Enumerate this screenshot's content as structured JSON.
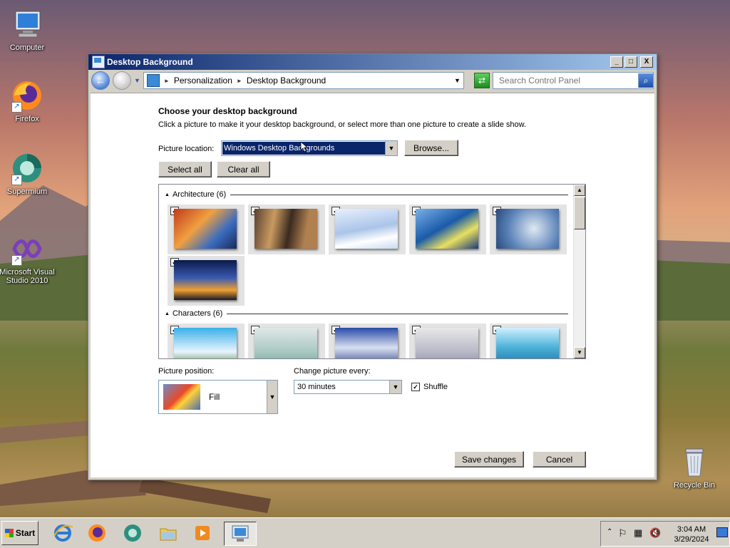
{
  "desktop": {
    "icons": [
      {
        "label": "Computer"
      },
      {
        "label": "Firefox"
      },
      {
        "label": "Supermium"
      },
      {
        "label": "Microsoft Visual Studio 2010"
      },
      {
        "label": "Recycle Bin"
      }
    ]
  },
  "window": {
    "title": "Desktop Background",
    "controls": {
      "minimize": "_",
      "maximize": "□",
      "close": "X"
    },
    "breadcrumb": [
      "Personalization",
      "Desktop Background"
    ],
    "search_placeholder": "Search Control Panel"
  },
  "content": {
    "heading": "Choose your desktop background",
    "description": "Click a picture to make it your desktop background, or select more than one picture to create a slide show.",
    "picture_location_label": "Picture location:",
    "picture_location_value": "Windows Desktop Backgrounds",
    "browse_label": "Browse...",
    "select_all_label": "Select all",
    "clear_all_label": "Clear all",
    "groups": [
      {
        "name": "Architecture (6)",
        "count": 6
      },
      {
        "name": "Characters (6)",
        "count": 6
      }
    ],
    "picture_position_label": "Picture position:",
    "picture_position_value": "Fill",
    "change_every_label": "Change picture every:",
    "change_every_value": "30 minutes",
    "shuffle_label": "Shuffle",
    "shuffle_checked": true,
    "save_label": "Save changes",
    "cancel_label": "Cancel"
  },
  "taskbar": {
    "start_label": "Start",
    "apps": [
      "internet-explorer-icon",
      "firefox-icon",
      "supermium-icon",
      "explorer-folder-icon",
      "media-player-icon",
      "control-panel-icon"
    ],
    "time": "3:04 AM",
    "date": "3/29/2024"
  },
  "colors": {
    "title_gradient_start": "#0a246a",
    "title_gradient_end": "#a6caf0",
    "selection": "#0a246a",
    "face": "#d4d0c8"
  }
}
